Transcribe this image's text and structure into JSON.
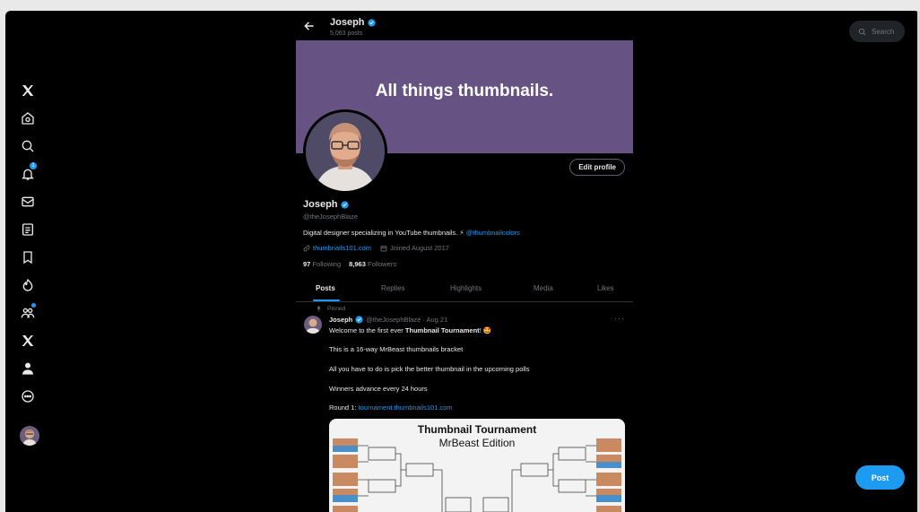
{
  "colors": {
    "accent": "#1d9bf0",
    "background": "#000000",
    "banner": "#665383",
    "muted": "#71767b"
  },
  "sidebar": {
    "items": [
      {
        "name": "x-logo-icon"
      },
      {
        "name": "home-icon"
      },
      {
        "name": "explore-icon"
      },
      {
        "name": "notifications-icon",
        "badge": "1"
      },
      {
        "name": "messages-icon"
      },
      {
        "name": "lists-icon"
      },
      {
        "name": "bookmarks-icon"
      },
      {
        "name": "spaces-icon"
      },
      {
        "name": "communities-icon"
      },
      {
        "name": "premium-x-icon"
      },
      {
        "name": "profile-icon"
      },
      {
        "name": "more-icon"
      }
    ]
  },
  "header": {
    "name": "Joseph",
    "posts": "5,063 posts"
  },
  "banner": {
    "text": "All things thumbnails."
  },
  "profile": {
    "edit_label": "Edit profile",
    "name": "Joseph",
    "handle": "@theJosephBlaze",
    "bio": "Digital designer specializing in YouTube thumbnails. ⚡",
    "bio_link": "@thumbnailcolors",
    "website": "thumbnails101.com",
    "joined": "Joined August 2017",
    "following_count": "97",
    "following_label": "Following",
    "followers_count": "8,963",
    "followers_label": "Followers"
  },
  "tabs": [
    "Posts",
    "Replies",
    "Highlights",
    "Media",
    "Likes"
  ],
  "post": {
    "pinned": "Pinned",
    "name": "Joseph",
    "handle": "@theJosephBlaze · Aug 21",
    "more": "···",
    "line1_pre": "Welcome to the first ever ",
    "line1_bold": "Thumbnail Tournament",
    "line1_post": "! 🤩",
    "line2": "This is a 16-way MrBeast thumbnails bracket",
    "line3": "All you have to do is pick the better thumbnail in the upcoming polls",
    "line4": "Winners advance every 24 hours",
    "line5_pre": "Round 1: ",
    "line5_link": "tournament.thumbnails101.com",
    "image_title": "Thumbnail Tournament",
    "image_subtitle": "MrBeast Edition"
  },
  "search": {
    "placeholder": "Search"
  },
  "post_button": "Post"
}
